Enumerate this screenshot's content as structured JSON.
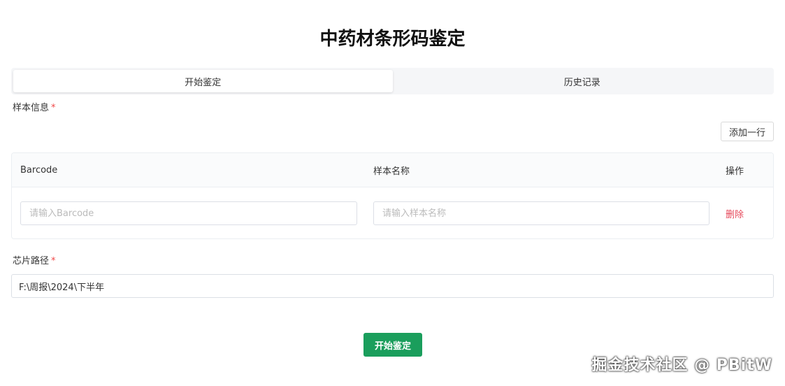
{
  "page": {
    "title": "中药材条形码鉴定"
  },
  "tabs": [
    {
      "label": "开始鉴定",
      "active": true
    },
    {
      "label": "历史记录",
      "active": false
    }
  ],
  "sample_info": {
    "label": "样本信息",
    "required_mark": "*",
    "add_row_label": "添加一行",
    "columns": [
      "Barcode",
      "样本名称",
      "操作"
    ],
    "rows": [
      {
        "barcode_value": "",
        "barcode_placeholder": "请输入Barcode",
        "name_value": "",
        "name_placeholder": "请输入样本名称",
        "delete_label": "删除"
      }
    ]
  },
  "chip_path": {
    "label": "芯片路径",
    "required_mark": "*",
    "value": "F:\\周报\\2024\\下半年"
  },
  "actions": {
    "start_label": "开始鉴定"
  },
  "watermark": {
    "text": "掘金技术社区 @ PBitW"
  },
  "colors": {
    "primary": "#1a9e5c",
    "danger": "#e6485a",
    "required": "#f04848"
  }
}
